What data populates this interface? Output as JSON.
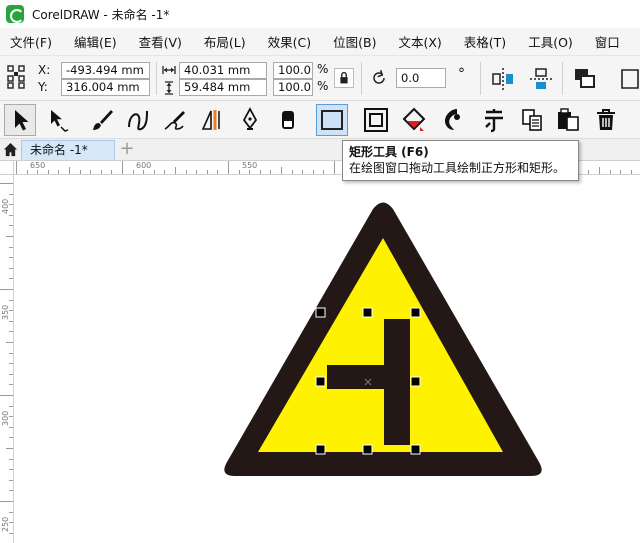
{
  "window": {
    "title": "CorelDRAW - 未命名 -1*"
  },
  "menu": [
    "文件(F)",
    "编辑(E)",
    "查看(V)",
    "布局(L)",
    "效果(C)",
    "位图(B)",
    "文本(X)",
    "表格(T)",
    "工具(O)",
    "窗口"
  ],
  "properties": {
    "x_label": "X:",
    "y_label": "Y:",
    "x_value": "-493.494 mm",
    "y_value": "316.004 mm",
    "width_value": "40.031 mm",
    "height_value": "59.484 mm",
    "scale_x": "100.0",
    "scale_y": "100.0",
    "percent": "%",
    "rotation": "0.0",
    "degree": "°"
  },
  "tools": [
    "pick-tool",
    "shape-tool",
    "artistic-media-tool",
    "freehand-tool",
    "smart-drawing-tool",
    "dimension-tool",
    "pen-tool",
    "eraser-tool",
    "rectangle-tool",
    "contour-tool",
    "interactive-fill-tool",
    "effects-tool",
    "text-tool",
    "copy-tool",
    "paste-tool",
    "delete-tool"
  ],
  "tabs": {
    "document": "未命名 -1*",
    "add": "+"
  },
  "ruler": {
    "h_labels": [
      "650",
      "600",
      "550"
    ],
    "v_labels": [
      "400",
      "350",
      "300",
      "250"
    ]
  },
  "tooltip": {
    "title": "矩形工具 (F6)",
    "description": "在绘图窗口拖动工具绘制正方形和矩形。"
  },
  "colors": {
    "sign_fill": "#fff200",
    "sign_border": "#231815",
    "tool_active": "#cfe3f6"
  }
}
